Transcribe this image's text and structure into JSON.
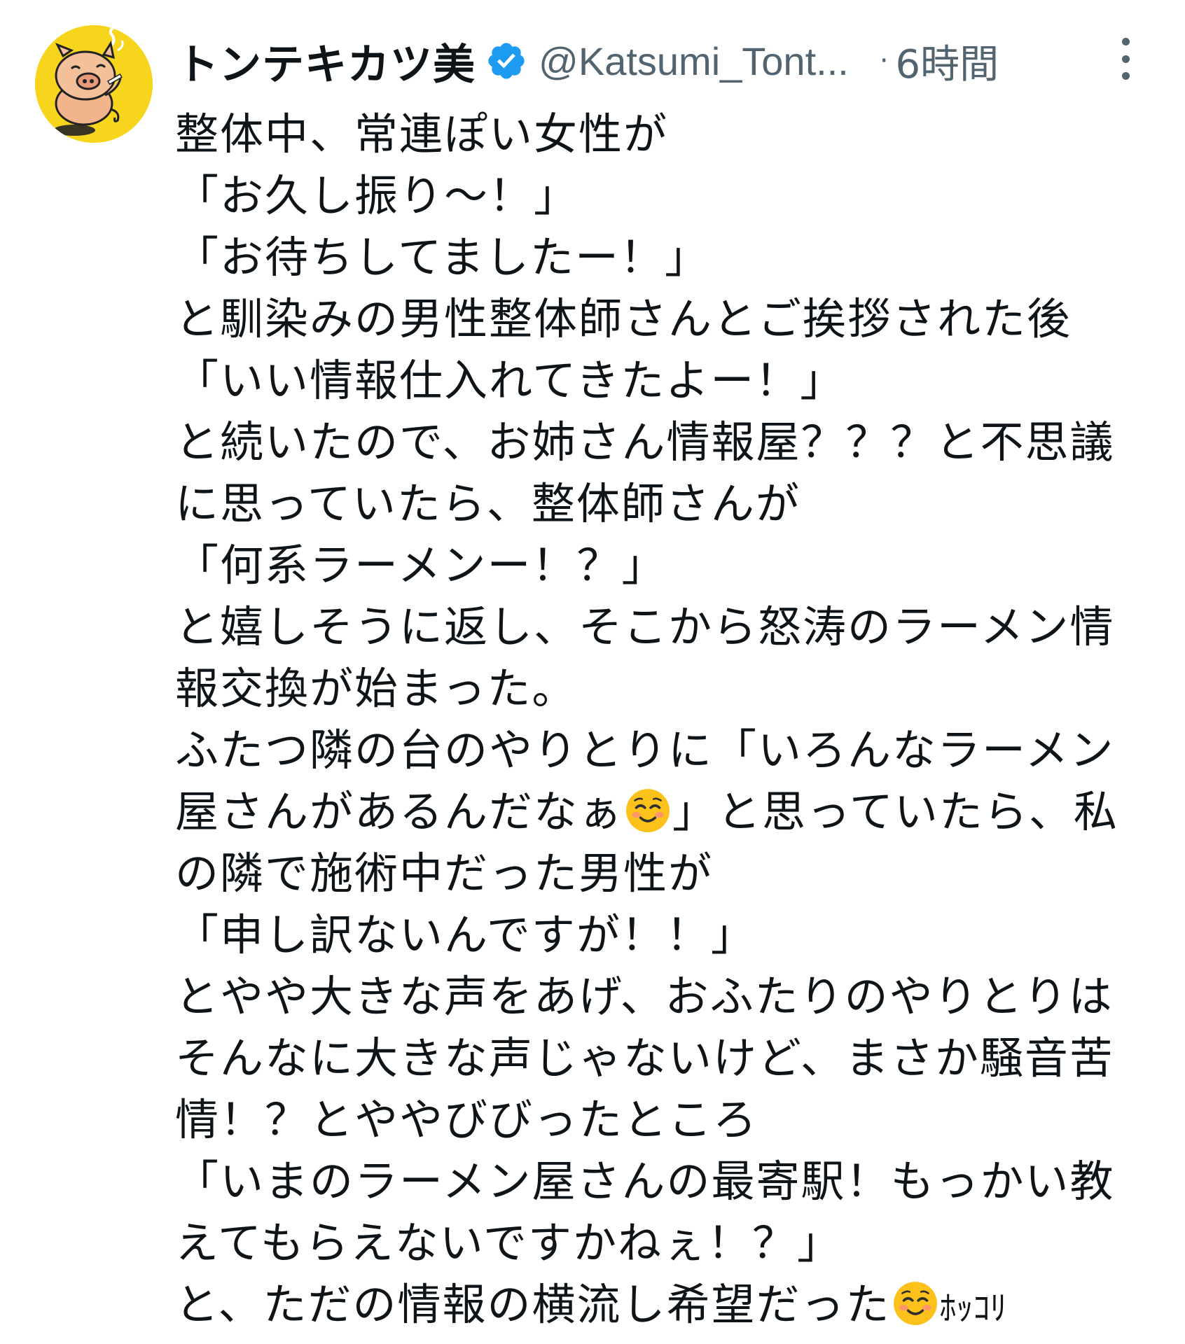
{
  "post": {
    "avatar_icon": "pig-mascot-avatar",
    "display_name": "トンテキカツ美",
    "verified_icon": "verified-badge-icon",
    "handle": "@Katsumi_Tont...",
    "separator": "·",
    "timestamp": "6時間",
    "more_icon": "more-options-icon",
    "colors": {
      "verified_blue": "#1d9bf0",
      "secondary_text": "#536471",
      "primary_text": "#0f1419",
      "avatar_bg": "#f7d51d"
    },
    "lines": [
      "整体中、常連ぽい女性が",
      "「お久し振り～！」",
      "「お待ちしてましたー！」",
      "と馴染みの男性整体師さんとご挨拶された後",
      "「いい情報仕入れてきたよー！」",
      "と続いたので、お姉さん情報屋？？？と不思議",
      "に思っていたら、整体師さんが",
      "「何系ラーメンー！？」",
      "と嬉しそうに返し、そこから怒涛のラーメン情",
      "報交換が始まった。",
      "ふたつ隣の台のやりとりに「いろんなラーメン",
      "屋さんがあるんだなぁ",
      "」と思っていたら、私",
      "の隣で施術中だった男性が",
      "「申し訳ないんですが！！」",
      "とやや大きな声をあげ、おふたりのやりとりは",
      "そんなに大きな声じゃないけど、まさか騒音苦",
      "情！？とややびびったところ",
      "「いまのラーメン屋さんの最寄駅！もっかい教",
      "えてもらえないですかねぇ！？」",
      "と、ただの情報の横流し希望だった",
      "ﾎｯｺﾘ"
    ],
    "emoji_name": "smiling-face-icon"
  }
}
